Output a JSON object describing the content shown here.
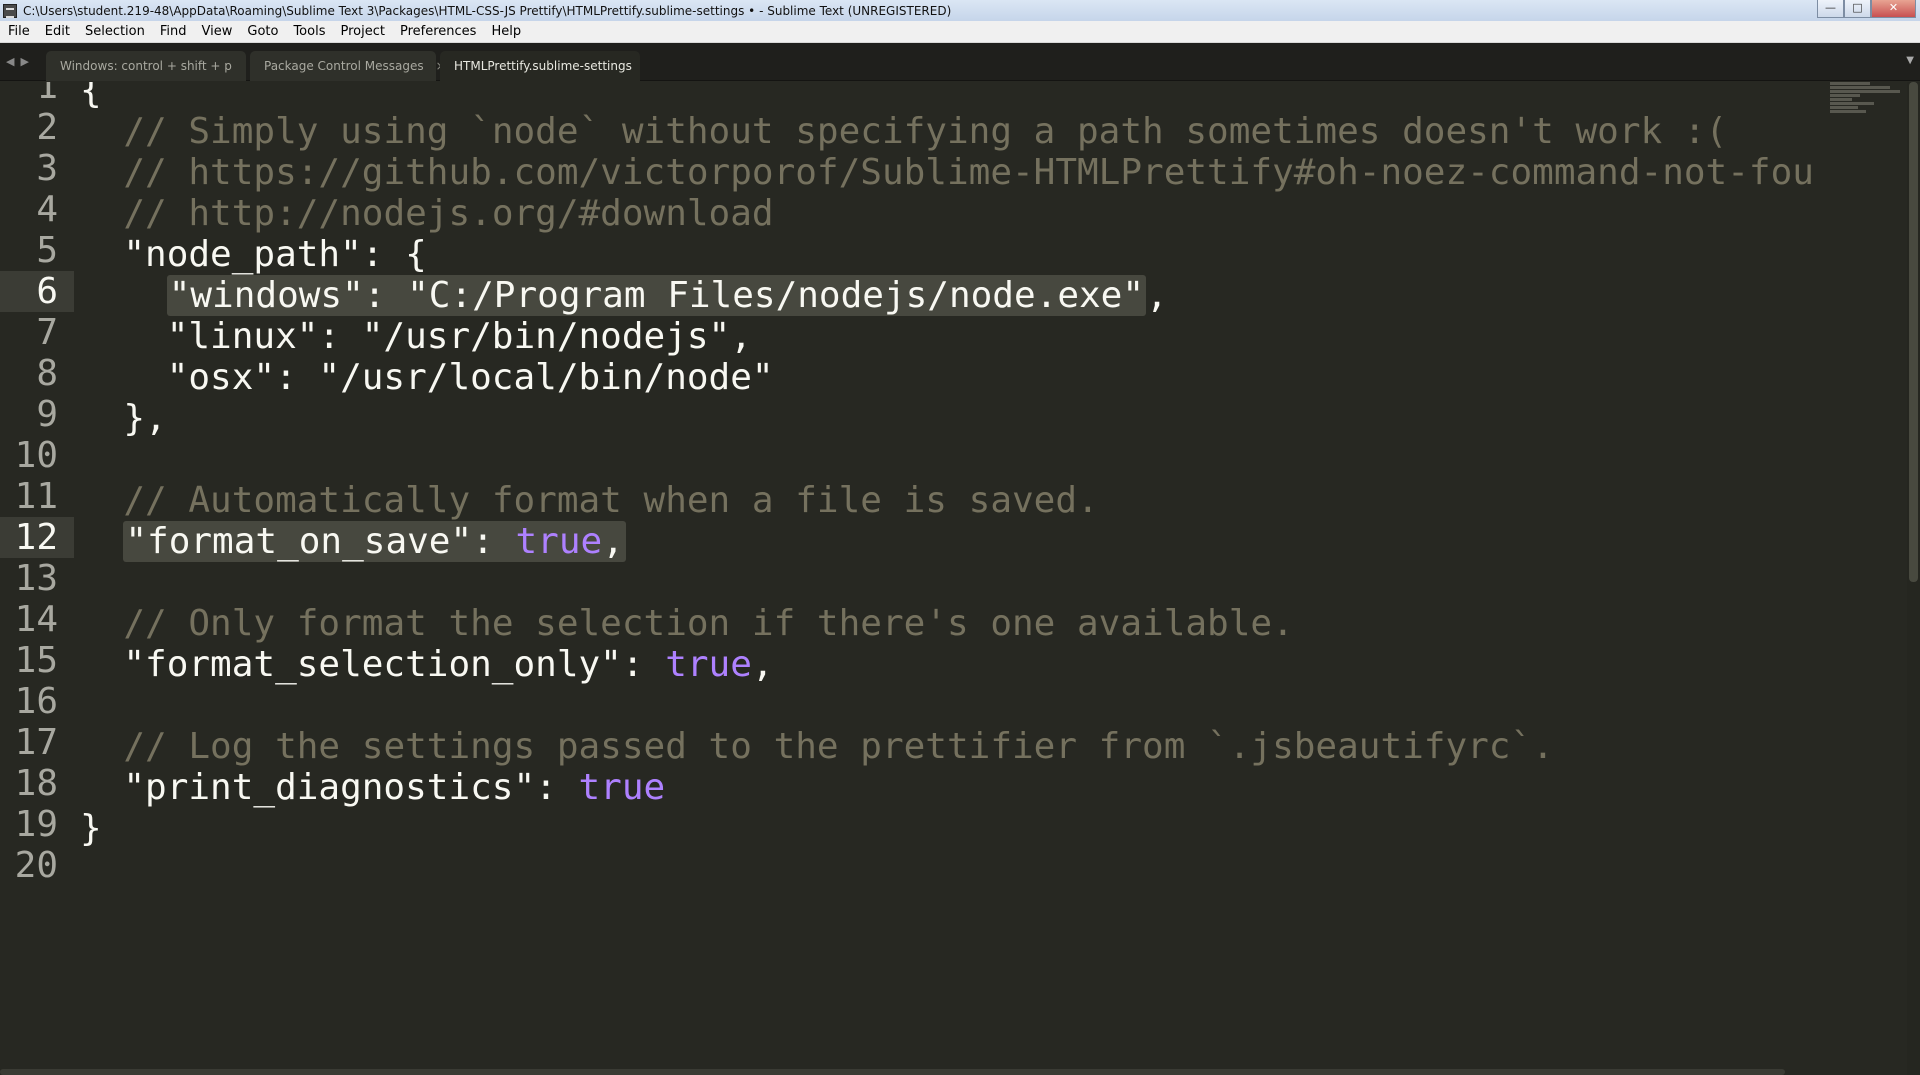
{
  "window": {
    "title": "C:\\Users\\student.219-48\\AppData\\Roaming\\Sublime Text 3\\Packages\\HTML-CSS-JS Prettify\\HTMLPrettify.sublime-settings • - Sublime Text (UNREGISTERED)",
    "minimize_label": "—",
    "maximize_label": "□",
    "close_label": "✕"
  },
  "menu": [
    "File",
    "Edit",
    "Selection",
    "Find",
    "View",
    "Goto",
    "Tools",
    "Project",
    "Preferences",
    "Help"
  ],
  "tabs": [
    {
      "label": "Windows: control + shift + p",
      "indicator": "dot"
    },
    {
      "label": "Package Control Messages",
      "indicator": "close",
      "close_glyph": "×"
    },
    {
      "label": "HTMLPrettify.sublime-settings",
      "indicator": "dot"
    }
  ],
  "icons": {
    "tab_prev": "◀",
    "tab_next": "▶",
    "tab_dropdown": "▼"
  },
  "editor": {
    "active_line_numbers": [
      6,
      12
    ],
    "lines": [
      {
        "num": "1",
        "text": "{"
      },
      {
        "num": "2",
        "indent": "  ",
        "comment": "// Simply using `node` without specifying a path sometimes doesn't work :("
      },
      {
        "num": "3",
        "indent": "  ",
        "comment": "// https://github.com/victorporof/Sublime-HTMLPrettify#oh-noez-command-not-fou"
      },
      {
        "num": "4",
        "indent": "  ",
        "comment": "// http://nodejs.org/#download"
      },
      {
        "num": "5",
        "text": "  \"node_path\": {"
      },
      {
        "num": "6",
        "indent": "    ",
        "selected": "\"windows\": \"C:/Program Files/nodejs/node.exe\"",
        "after": ","
      },
      {
        "num": "7",
        "text": "    \"linux\": \"/usr/bin/nodejs\","
      },
      {
        "num": "8",
        "text": "    \"osx\": \"/usr/local/bin/node\""
      },
      {
        "num": "9",
        "text": "  },"
      },
      {
        "num": "10",
        "text": ""
      },
      {
        "num": "11",
        "indent": "  ",
        "comment": "// Automatically format when a file is saved."
      },
      {
        "num": "12",
        "indent": "  ",
        "sel_key": "\"format_on_save\": ",
        "sel_value": "true",
        "sel_after": ","
      },
      {
        "num": "13",
        "text": ""
      },
      {
        "num": "14",
        "indent": "  ",
        "comment": "// Only format the selection if there's one available."
      },
      {
        "num": "15",
        "key": "  \"format_selection_only\": ",
        "value": "true",
        "after": ","
      },
      {
        "num": "16",
        "text": ""
      },
      {
        "num": "17",
        "indent": "  ",
        "comment": "// Log the settings passed to the prettifier from `.jsbeautifyrc`."
      },
      {
        "num": "18",
        "key": "  \"print_diagnostics\": ",
        "value": "true",
        "after": ""
      },
      {
        "num": "19",
        "text": "}"
      },
      {
        "num": "20",
        "text": ""
      }
    ]
  },
  "colors": {
    "background": "#272822",
    "text": "#f8f8f2",
    "comment": "#75715e",
    "constant": "#ae81ff",
    "selection": "#47483f"
  }
}
